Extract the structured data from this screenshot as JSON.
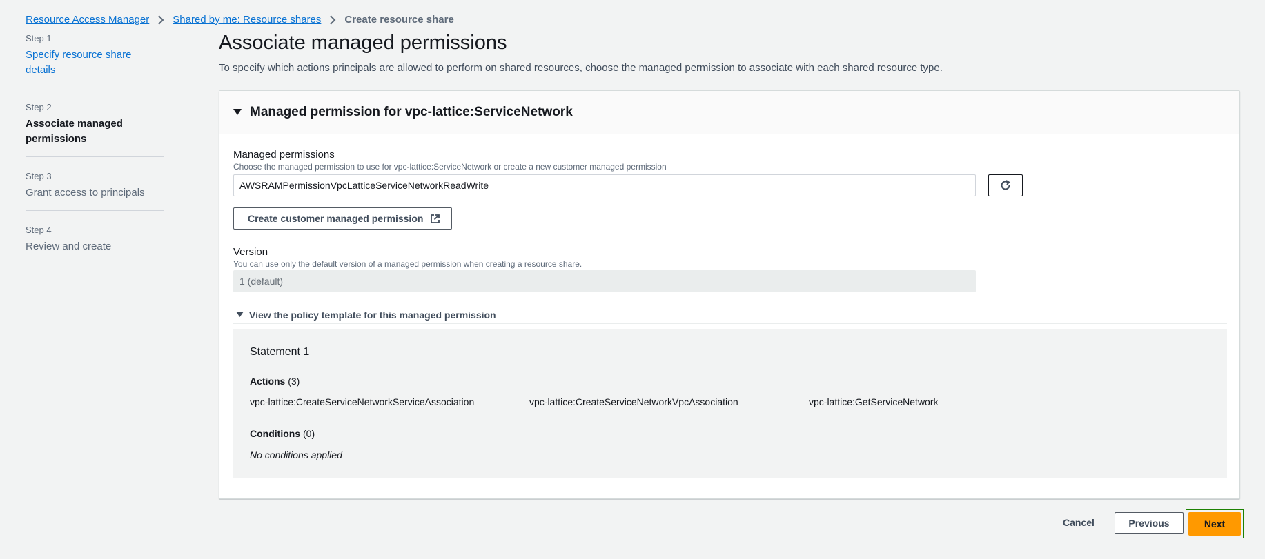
{
  "breadcrumb": {
    "items": [
      "Resource Access Manager",
      "Shared by me: Resource shares"
    ],
    "current": "Create resource share"
  },
  "steps": [
    {
      "num": "Step 1",
      "title": "Specify resource share details"
    },
    {
      "num": "Step 2",
      "title": "Associate managed permissions"
    },
    {
      "num": "Step 3",
      "title": "Grant access to principals"
    },
    {
      "num": "Step 4",
      "title": "Review and create"
    }
  ],
  "page": {
    "title": "Associate managed permissions",
    "description": "To specify which actions principals are allowed to perform on shared resources, choose the managed permission to associate with each shared resource type."
  },
  "panel": {
    "header": "Managed permission for vpc-lattice:ServiceNetwork",
    "permissions_label": "Managed permissions",
    "permissions_desc": "Choose the managed permission to use for vpc-lattice:ServiceNetwork or create a new customer managed permission",
    "permissions_value": "AWSRAMPermissionVpcLatticeServiceNetworkReadWrite",
    "create_button": "Create customer managed permission",
    "version_label": "Version",
    "version_desc": "You can use only the default version of a managed permission when creating a resource share.",
    "version_value": "1 (default)",
    "policy_expander": "View the policy template for this managed permission",
    "statement": "Statement 1",
    "actions_label": "Actions",
    "actions_count": "(3)",
    "actions": [
      "vpc-lattice:CreateServiceNetworkServiceAssociation",
      "vpc-lattice:CreateServiceNetworkVpcAssociation",
      "vpc-lattice:GetServiceNetwork"
    ],
    "conditions_label": "Conditions",
    "conditions_count": "(0)",
    "no_conditions": "No conditions applied"
  },
  "footer": {
    "cancel": "Cancel",
    "previous": "Previous",
    "next": "Next"
  },
  "colors": {
    "link": "#0972d3",
    "primary_button": "#ff9900",
    "focus_ring": "#1d8102"
  }
}
